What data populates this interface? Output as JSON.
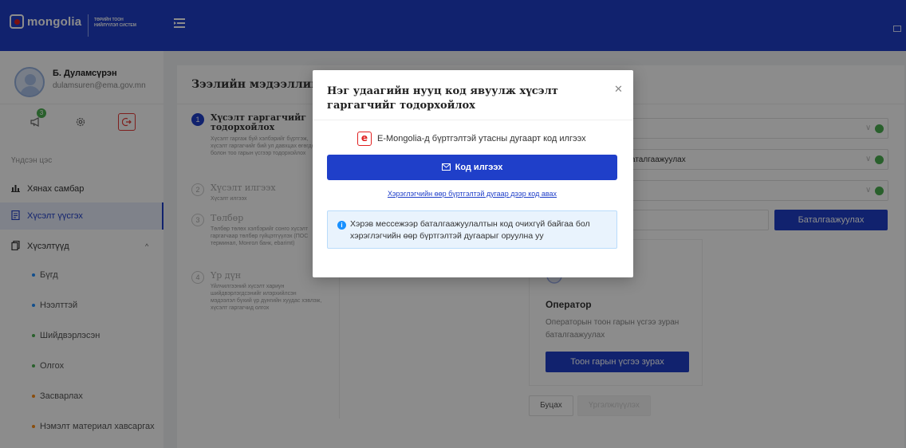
{
  "brand": {
    "name": "mongolia",
    "system": "ТӨРИЙН ТООН НИЙЛҮҮЛЭЛ СИСТЕМ"
  },
  "profile": {
    "name": "Б. Дуламсүрэн",
    "email": "dulamsuren@ema.gov.mn",
    "notification_count": "3"
  },
  "sidebar": {
    "section_label": "Үндсэн цэс",
    "items": [
      {
        "label": "Хянах самбар",
        "icon": "chart-icon"
      },
      {
        "label": "Хүсэлт үүсгэх",
        "icon": "document-icon",
        "active": true
      },
      {
        "label": "Хүсэлтүүд",
        "icon": "copy-icon"
      }
    ],
    "sub_items": [
      {
        "label": "Бүгд",
        "color": "#1f8fff"
      },
      {
        "label": "Нээлттэй",
        "color": "#1f8fff"
      },
      {
        "label": "Шийдвэрлэсэн",
        "color": "#4caf50"
      },
      {
        "label": "Олгох",
        "color": "#4caf50"
      },
      {
        "label": "Засварлах",
        "color": "#fa8c16"
      },
      {
        "label": "Нэмэлт материал хавсаргах",
        "color": "#fa8c16"
      }
    ]
  },
  "main": {
    "title": "Зээлийн мэдээллийн",
    "steps": [
      {
        "number": "1",
        "title": "Хүсэлт гаргагчийг тодорхойлох",
        "desc": "Хүсэлт гаргаж буй хэлбэрийг бүртгэж, хүсэлт гаргагчийг бий ул давхцах өгөгдөл болон тоо гарын үсгээр тодорхойлох"
      },
      {
        "number": "2",
        "title": "Хүсэлт илгээх",
        "desc": "Хүсэлт илгээх"
      },
      {
        "number": "3",
        "title": "Төлбөр",
        "desc": "Төлбөр төлөх хэлбэрийг сонго хүсэлт гаргагчаар төлбөр гүйцэтгүүлэх (ПОС терминал, Монгол банк, ebarimt)"
      },
      {
        "number": "4",
        "title": "Үр дүн",
        "desc": "Үйлчилгээний хүсэлт хариун шийдвэрлэгдсэнийг илэрхийлсэн мэдээлэл бүхий үр дүнгийн хуудас хэвлэж, хүсэлт гаргагчид олгох"
      }
    ],
    "field_partial_text": "аталгаажуулах",
    "verify_button": "Баталгаажуулах",
    "operator": {
      "title": "Оператор",
      "desc": "Операторын тоон гарын үсгээ зуран баталгаажуулах",
      "button": "Тоон гарын үсгээ зурах"
    },
    "back_button": "Буцах",
    "next_button": "Үргэлжлүүлэх"
  },
  "modal": {
    "title": "Нэг удаагийн нууц код явуулж хүсэлт гаргагчийг тодорхойлох",
    "emongolia_text": "E-Mongolia-д бүртгэлтэй утасны дугаарт код илгээх",
    "send_button": "Код илгээх",
    "alt_link": "Хэрэглэгчийн өөр бүртгэлтэй дугаар дээр код авах",
    "info_text": "Хэрэв мессежээр баталгаажуулалтын код очихгүй байгаа бол хэрэглэгчийн өөр бүртгэлтэй дугаарыг оруулна уу"
  }
}
